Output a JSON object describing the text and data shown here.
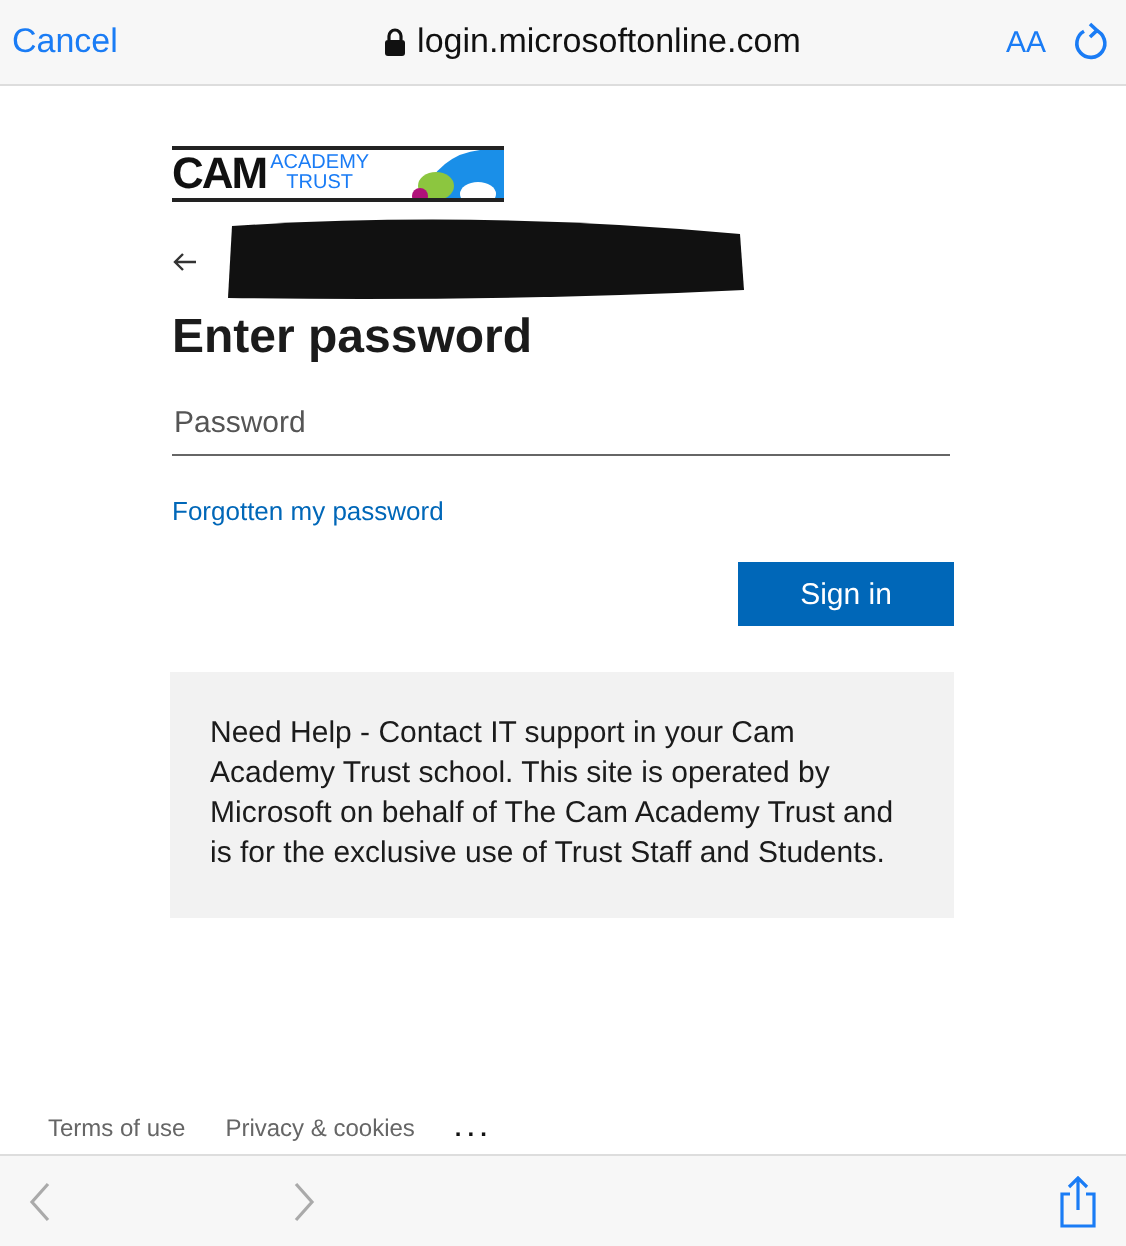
{
  "browser_bar": {
    "cancel": "Cancel",
    "address": "login.microsoftonline.com",
    "text_size": "AA"
  },
  "logo": {
    "main": "CAM",
    "line_1": "ACADEMY",
    "line_2": "TRUST"
  },
  "heading": "Enter password",
  "password_field": {
    "placeholder": "Password"
  },
  "forgot_link": "Forgotten my password",
  "sign_in_button": "Sign in",
  "help_text": "Need Help - Contact IT support in your Cam Academy Trust school. This site is operated by Microsoft on behalf of The Cam Academy Trust and is for the exclusive use of Trust Staff and Students.",
  "footer_links": [
    "Terms of use",
    "Privacy & cookies",
    "..."
  ],
  "toolbar": {
    "back_disabled": true,
    "forward_disabled": true
  }
}
